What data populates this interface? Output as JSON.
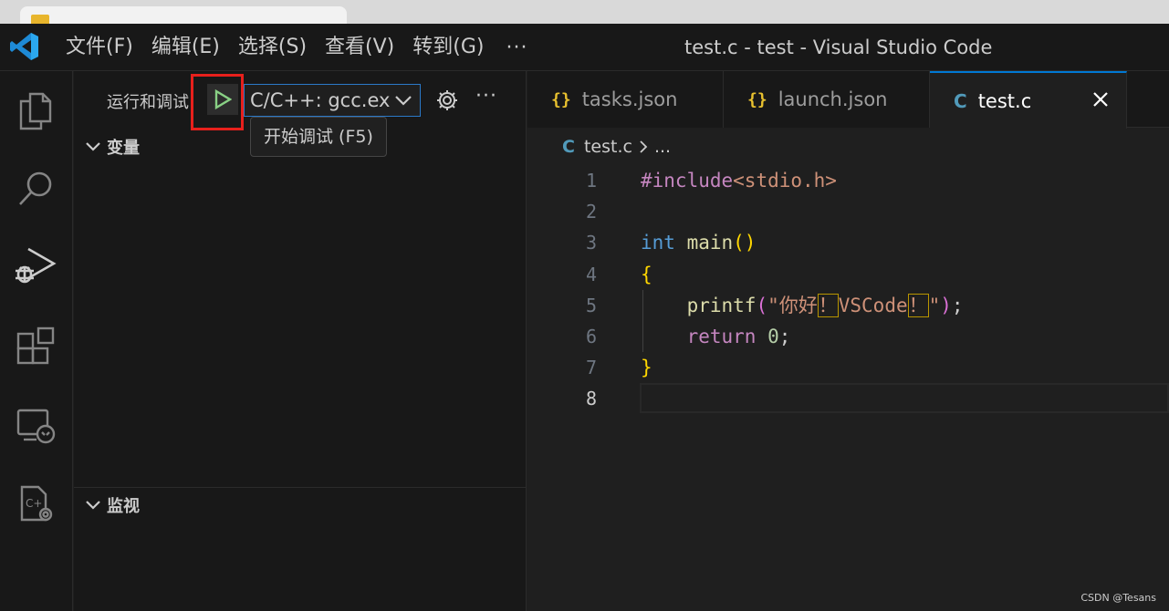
{
  "window": {
    "title": "test.c - test - Visual Studio Code"
  },
  "menu": {
    "items": [
      "文件(F)",
      "编辑(E)",
      "选择(S)",
      "查看(V)",
      "转到(G)"
    ],
    "more": "···"
  },
  "sidebar": {
    "header": "运行和调试",
    "config_value": "C/C++: gcc.ex",
    "more": "···",
    "tooltip": "开始调试 (F5)",
    "sections": {
      "variables": "变量",
      "watch": "监视"
    }
  },
  "tabs": [
    {
      "icon": "{}",
      "label": "tasks.json",
      "icon_color": "#e8c12f"
    },
    {
      "icon": "{}",
      "label": "launch.json",
      "icon_color": "#e8c12f"
    },
    {
      "icon": "C",
      "label": "test.c",
      "icon_color": "#519aba",
      "active": true
    }
  ],
  "breadcrumb": {
    "icon": "C",
    "file": "test.c",
    "rest": "..."
  },
  "editor": {
    "line_numbers": [
      "1",
      "2",
      "3",
      "4",
      "5",
      "6",
      "7",
      "8"
    ],
    "current_line": 8,
    "code": {
      "l1_directive": "#include",
      "l1_header": "<stdio.h>",
      "l3_type": "int",
      "l3_name": " main",
      "l3_parens": "()",
      "l4_brace": "{",
      "l5_fn": "printf",
      "l5_open": "(",
      "l5_str_a": "\"你好",
      "l5_mark1": "！",
      "l5_str_b": "VSCode",
      "l5_mark2": "！",
      "l5_str_c": "\"",
      "l5_close": ")",
      "l5_semi": ";",
      "l6_kw": "return",
      "l6_num": "0",
      "l6_semi": ";",
      "l7_brace": "}"
    }
  },
  "watermark": "CSDN @Tesans"
}
